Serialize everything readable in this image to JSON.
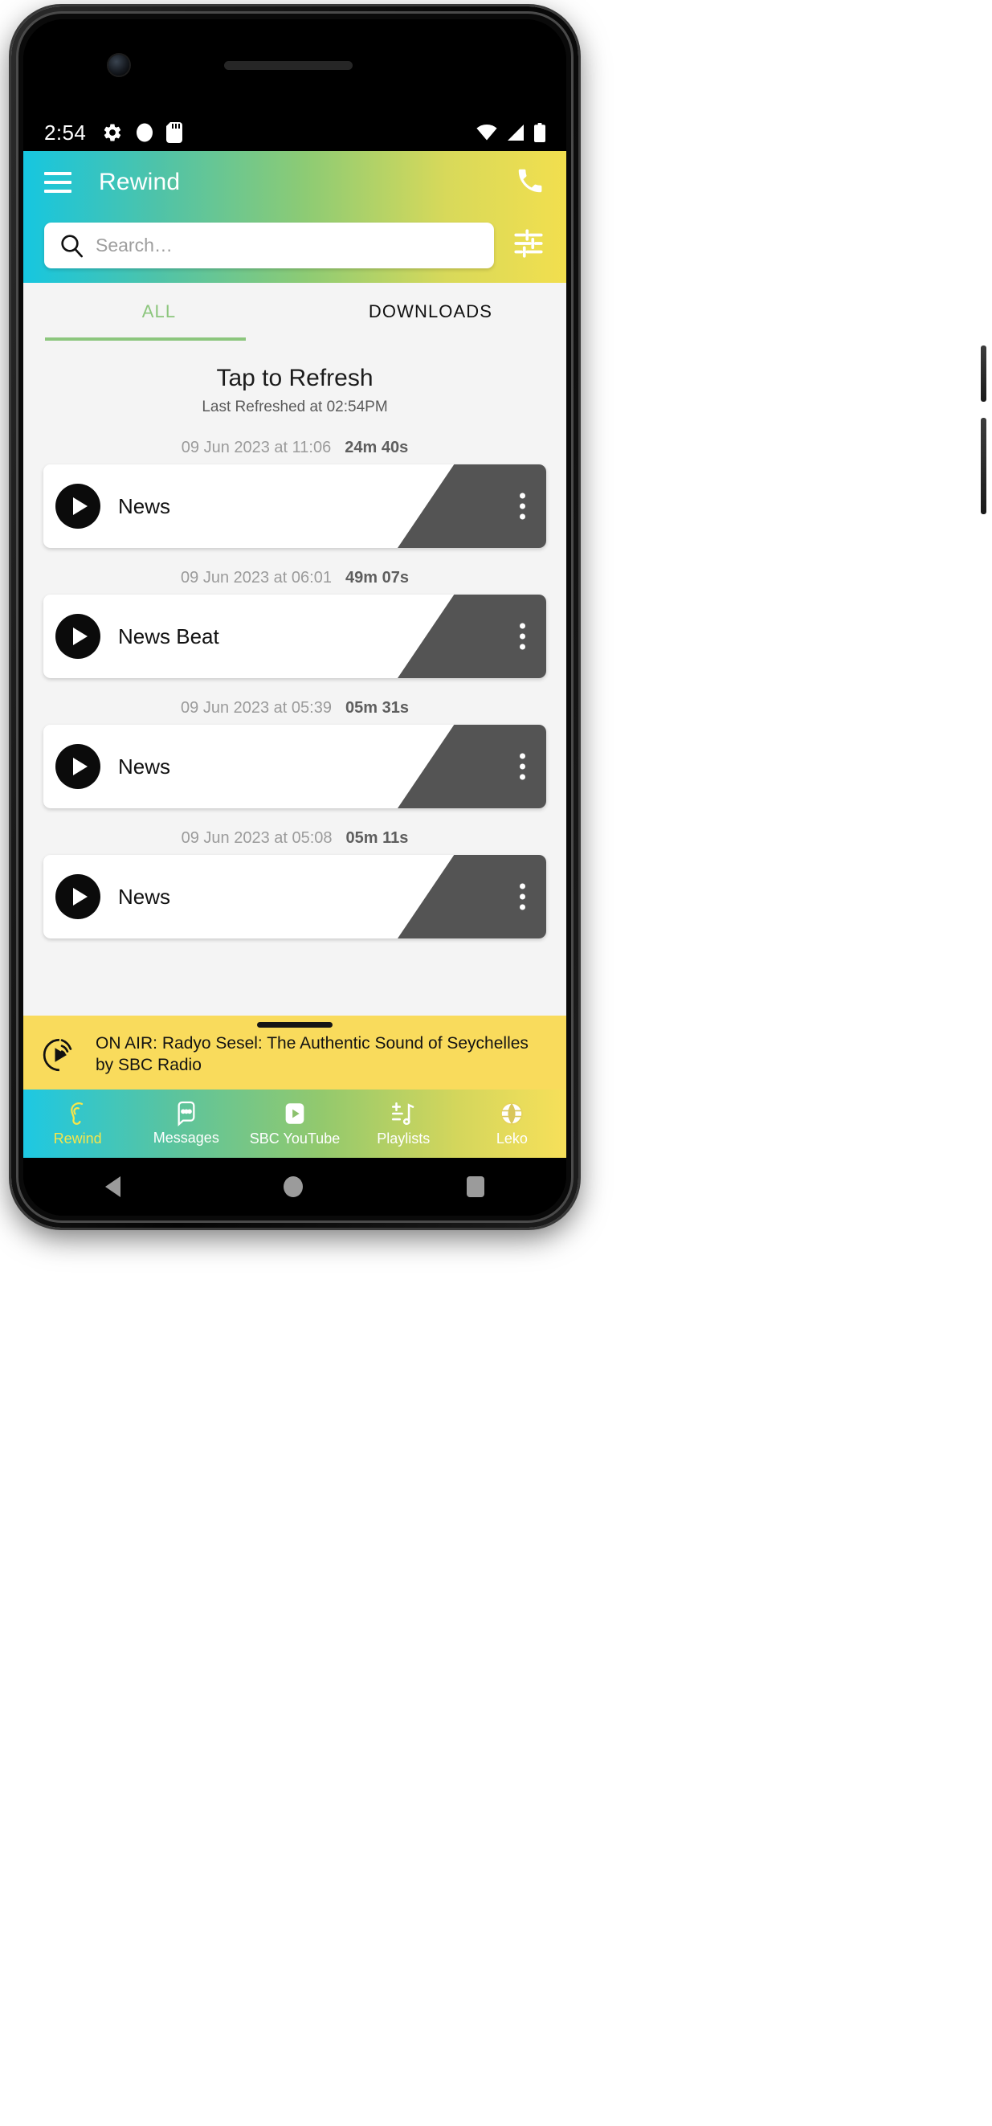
{
  "statusbar": {
    "time": "2:54",
    "left_icons": [
      "gear-icon",
      "circle-icon",
      "sd-card-icon"
    ],
    "right_icons": [
      "wifi-icon",
      "signal-icon",
      "battery-icon"
    ]
  },
  "appbar": {
    "title": "Rewind",
    "menu_icon": "hamburger-menu-icon",
    "call_icon": "phone-icon",
    "gradient_start": "#16c6e0",
    "gradient_end": "#f2df4e"
  },
  "search": {
    "placeholder": "Search…",
    "value": "",
    "icon": "search-icon",
    "filter_icon": "tune-icon"
  },
  "tabs": [
    {
      "label": "ALL",
      "active": true
    },
    {
      "label": "DOWNLOADS",
      "active": false
    }
  ],
  "refresh": {
    "title": "Tap to Refresh",
    "subtitle": "Last Refreshed at  02:54PM"
  },
  "episodes": [
    {
      "date": "09 Jun 2023 at 11:06",
      "duration": "24m 40s",
      "title": "News"
    },
    {
      "date": "09 Jun 2023 at 06:01",
      "duration": "49m 07s",
      "title": "News Beat"
    },
    {
      "date": "09 Jun 2023 at 05:39",
      "duration": "05m 31s",
      "title": "News"
    },
    {
      "date": "09 Jun 2023 at 05:08",
      "duration": "05m 11s",
      "title": "News"
    }
  ],
  "onair": {
    "line1": "ON AIR: Radyo Sesel: The Authentic Sound of Seychelles",
    "line2": "by SBC Radio",
    "icon": "broadcast-play-icon",
    "background": "#f9db5c"
  },
  "bottomnav": [
    {
      "label": "Rewind",
      "icon": "ear-icon",
      "active": true
    },
    {
      "label": "Messages",
      "icon": "message-bubble-icon",
      "active": false
    },
    {
      "label": "SBC YouTube",
      "icon": "play-rect-icon",
      "active": false
    },
    {
      "label": "Playlists",
      "icon": "playlist-add-icon",
      "active": false
    },
    {
      "label": "Leko",
      "icon": "globe-icon",
      "active": false
    }
  ],
  "sysnav": {
    "back": "back-triangle-icon",
    "home": "home-circle-icon",
    "recents": "recents-square-icon"
  }
}
